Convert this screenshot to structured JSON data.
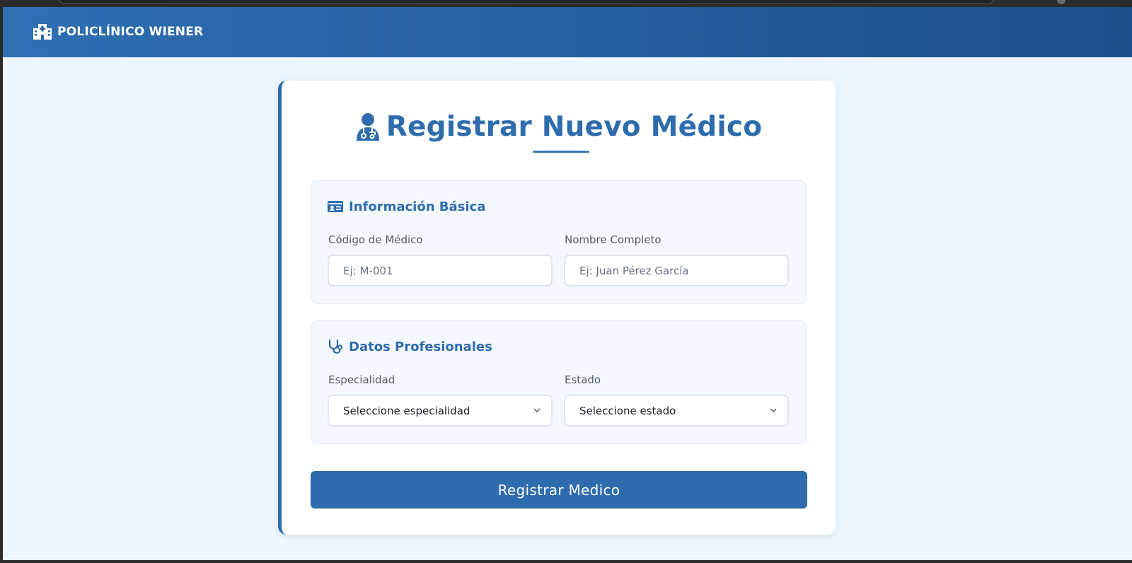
{
  "navbar": {
    "brand": "POLICLÍNICO WIENER",
    "brand_icon": "hospital-icon"
  },
  "form": {
    "title": "Registrar Nuevo Médico",
    "title_icon": "doctor-icon",
    "sections": [
      {
        "heading": "Información Básica",
        "icon": "id-card-icon",
        "fields": [
          {
            "label": "Código de Médico",
            "placeholder": "Ej: M-001",
            "value": ""
          },
          {
            "label": "Nombre Completo",
            "placeholder": "Ej: Juan Pérez García",
            "value": ""
          }
        ]
      },
      {
        "heading": "Datos Profesionales",
        "icon": "stethoscope-icon",
        "fields": [
          {
            "label": "Especialidad",
            "selected": "Seleccione especialidad"
          },
          {
            "label": "Estado",
            "selected": "Seleccione estado"
          }
        ]
      }
    ],
    "submit_label": "Registrar Medico"
  },
  "colors": {
    "primary": "#2e6cad",
    "navbar_start": "#2e6fb3",
    "navbar_end": "#1f4f8c",
    "page_bg": "#eef6fd",
    "section_bg": "#f4f8fc"
  }
}
